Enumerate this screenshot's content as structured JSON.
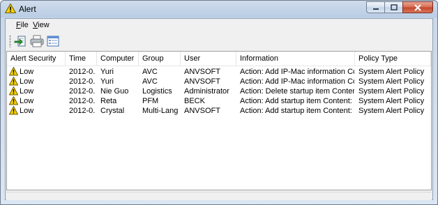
{
  "window": {
    "title": "Alert",
    "title_icon": "warning-icon"
  },
  "menu": [
    {
      "label_pre": "",
      "mnemonic": "F",
      "label_post": "ile"
    },
    {
      "label_pre": "",
      "mnemonic": "V",
      "label_post": "iew"
    }
  ],
  "toolbar": {
    "buttons": [
      "export-icon",
      "print-icon",
      "details-icon"
    ]
  },
  "table": {
    "columns": [
      "Alert Security",
      "Time",
      "Computer",
      "Group",
      "User",
      "Information",
      "Policy Type"
    ],
    "rows": [
      {
        "severity": "Low",
        "time": "2012-0...",
        "computer": "Yuri",
        "group": "AVC",
        "user": "ANVSOFT",
        "info": "Action: Add IP-Mac information  Cont...",
        "policy": "System Alert Policy"
      },
      {
        "severity": "Low",
        "time": "2012-0...",
        "computer": "Yuri",
        "group": "AVC",
        "user": "ANVSOFT",
        "info": "Action: Add IP-Mac information  Cont...",
        "policy": "System Alert Policy"
      },
      {
        "severity": "Low",
        "time": "2012-0...",
        "computer": "Nie Guo",
        "group": "Logistics",
        "user": "Administrator",
        "info": "Action: Delete startup item  Content: ...",
        "policy": "System Alert Policy"
      },
      {
        "severity": "Low",
        "time": "2012-0...",
        "computer": "Reta",
        "group": "PFM",
        "user": "BECK",
        "info": "Action: Add startup item  Content: C:\\...",
        "policy": "System Alert Policy"
      },
      {
        "severity": "Low",
        "time": "2012-0...",
        "computer": "Crystal",
        "group": "Multi-Lang",
        "user": "ANVSOFT",
        "info": "Action: Add startup item  Content: C:\\...",
        "policy": "System Alert Policy"
      }
    ]
  },
  "colors": {
    "warning_yellow": "#f5d000",
    "close_red": "#c2442a"
  }
}
